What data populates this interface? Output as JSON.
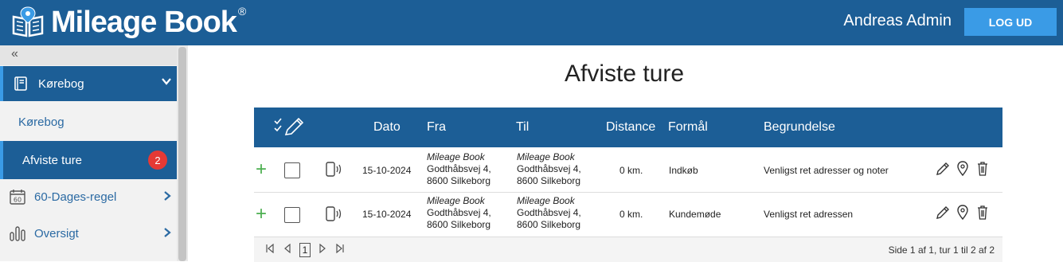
{
  "header": {
    "logo_text": "Mileage Book",
    "logo_reg": "®",
    "user_name": "Andreas Admin",
    "logout_label": "LOG UD"
  },
  "sidebar": {
    "collapse_label": "«",
    "main": {
      "label": "Kørebog",
      "icon": "book-icon"
    },
    "sub_items": [
      {
        "label": "Kørebog"
      },
      {
        "label": "Afviste ture",
        "badge": "2"
      }
    ],
    "items": [
      {
        "label": "60-Dages-regel",
        "icon": "calendar-60-icon"
      },
      {
        "label": "Oversigt",
        "icon": "bar-chart-icon"
      }
    ]
  },
  "page": {
    "title": "Afviste ture"
  },
  "table": {
    "columns": {
      "dato": "Dato",
      "fra": "Fra",
      "til": "Til",
      "distance": "Distance",
      "formaal": "Formål",
      "begrundelse": "Begrundelse"
    },
    "rows": [
      {
        "dato": "15-10-2024",
        "fra_name": "Mileage Book",
        "fra_street": "Godthåbsvej 4,",
        "fra_city": "8600 Silkeborg",
        "til_name": "Mileage Book",
        "til_street": "Godthåbsvej 4,",
        "til_city": "8600 Silkeborg",
        "distance": "0 km.",
        "formaal": "Indkøb",
        "begrundelse": "Venligst ret adresser og noter"
      },
      {
        "dato": "15-10-2024",
        "fra_name": "Mileage Book",
        "fra_street": "Godthåbsvej 4,",
        "fra_city": "8600 Silkeborg",
        "til_name": "Mileage Book",
        "til_street": "Godthåbsvej 4,",
        "til_city": "8600 Silkeborg",
        "distance": "0 km.",
        "formaal": "Kundemøde",
        "begrundelse": "Venligst ret adressen"
      }
    ],
    "pager": {
      "current_page": "1",
      "info": "Side 1 af 1, tur 1 til 2 af 2"
    }
  },
  "colors": {
    "primary": "#1c5e96",
    "accent": "#3a9be6",
    "badge": "#e53935",
    "plus": "#4caf50"
  }
}
